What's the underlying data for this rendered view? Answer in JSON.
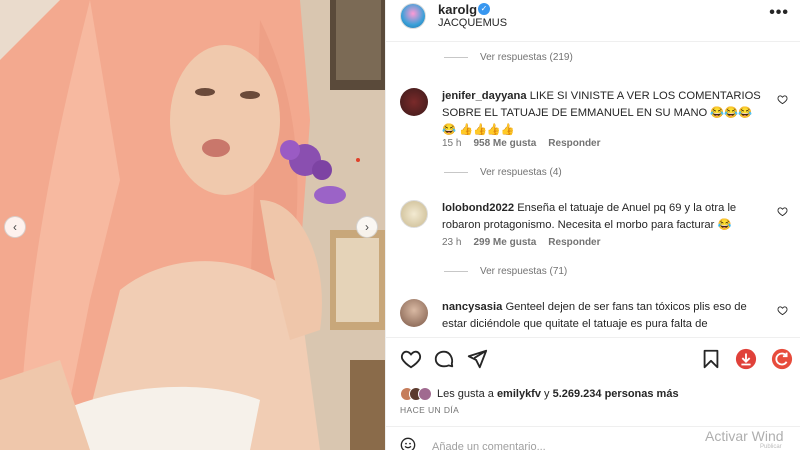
{
  "post": {
    "username": "karolg",
    "location": "JACQUEMUS",
    "more_label": "•••"
  },
  "thread": [
    {
      "type": "replies",
      "label": "Ver respuestas (219)"
    },
    {
      "type": "comment",
      "username": "jenifer_dayyana",
      "text": "LIKE SI VINISTE A VER LOS COMENTARIOS SOBRE EL TATUAJE DE EMMANUEL EN SU MANO 😂😂😂😂 👍👍👍👍",
      "time": "15 h",
      "likes": "958 Me gusta",
      "reply": "Responder"
    },
    {
      "type": "replies",
      "label": "Ver respuestas (4)"
    },
    {
      "type": "comment",
      "username": "lolobond2022",
      "text": "Enseña el tatuaje de Anuel pq 69 y la otra le robaron protagonismo. Necesita el morbo para facturar 😂",
      "time": "23 h",
      "likes": "299 Me gusta",
      "reply": "Responder"
    },
    {
      "type": "replies",
      "label": "Ver respuestas (71)"
    },
    {
      "type": "comment",
      "username": "nancysasia",
      "text": "Genteel dejen de ser fans tan tóxicos plis eso de estar diciéndole que quitate el tatuaje es pura falta de"
    }
  ],
  "likes": {
    "prefix": "Les gusta a",
    "user": "emilykfv",
    "connector": "y",
    "count": "5.269.234 personas más"
  },
  "time_ago": "HACE UN DÍA",
  "comment_input": {
    "placeholder": "Añade un comentario..."
  },
  "icons": [
    "heart-icon",
    "comment-icon",
    "share-icon",
    "bookmark-icon",
    "download-icon",
    "refresh-icon",
    "emoji-icon",
    "verified-icon"
  ],
  "os_watermark": {
    "title": "Activar Wind",
    "sub": "Publicar"
  },
  "colors": {
    "accent": "#3897f0",
    "download": "#e0413a",
    "refresh": "#e74c3c"
  }
}
